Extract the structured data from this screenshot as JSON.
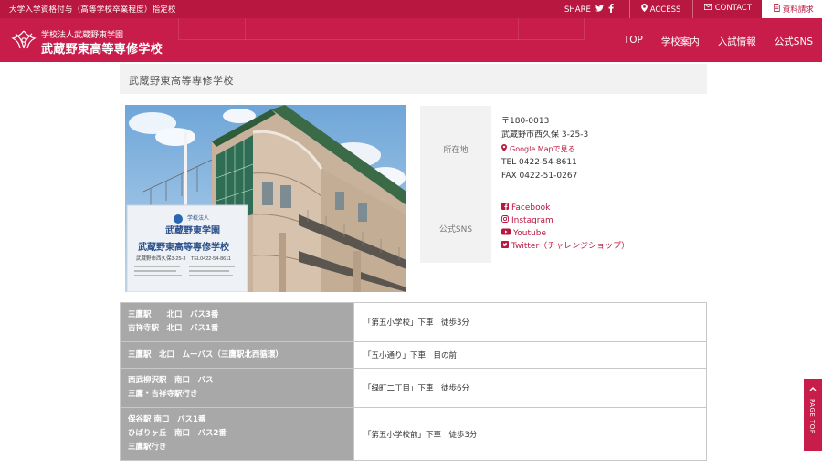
{
  "topbar": {
    "tagline": "大学入学資格付与（高等学校卒業程度）指定校",
    "share_label": "SHARE",
    "access_label": "ACCESS",
    "contact_label": "CONTACT",
    "request_label": "資料請求"
  },
  "header": {
    "org_name": "学校法人武蔵野東学園",
    "school_name": "武蔵野東高等専修学校",
    "nav": [
      "TOP",
      "学校案内",
      "入試情報",
      "公式SNS"
    ]
  },
  "page_title": "武蔵野東高等専修学校",
  "photo": {
    "sign_org": "学校法人",
    "sign_name1": "武蔵野東学園",
    "sign_name2": "武蔵野東高等専修学校",
    "sign_addr": "武蔵野市西久保3-25-3",
    "sign_tel": "TEL0422-54-8611"
  },
  "info": {
    "address_label": "所在地",
    "postal": "〒180-0013",
    "address": "武蔵野市西久保 3-25-3",
    "map_link": "Google Mapで見る",
    "tel": "TEL 0422-54-8611",
    "fax": "FAX 0422-51-0267",
    "sns_label": "公式SNS",
    "sns": [
      {
        "icon": "facebook-icon",
        "label": "Facebook"
      },
      {
        "icon": "instagram-icon",
        "label": "Instagram"
      },
      {
        "icon": "youtube-icon",
        "label": "Youtube"
      },
      {
        "icon": "twitter-icon",
        "label": "Twitter（チャレンジショップ）"
      }
    ]
  },
  "access_table": [
    {
      "route": [
        "三鷹駅　　北口　バス3番",
        "吉祥寺駅　北口　バス1番"
      ],
      "stop": "「第五小学校」下車　徒歩3分"
    },
    {
      "route": [
        "三鷹駅　北口　ムーバス（三鷹駅北西循環）"
      ],
      "stop": "「五小通り」下車　目の前"
    },
    {
      "route": [
        "西武柳沢駅　南口　バス",
        "三鷹・吉祥寺駅行き"
      ],
      "stop": "「緑町二丁目」下車　徒歩6分"
    },
    {
      "route": [
        "保谷駅 南口　バス1番",
        "ひばりヶ丘　南口　バス2番",
        "三鷹駅行き"
      ],
      "stop": "「第五小学校前」下車　徒歩3分"
    }
  ],
  "page_top_label": "PAGE TOP",
  "colors": {
    "brand": "#c81d4a",
    "brand_dark": "#b8173f",
    "route_cell": "#a8a8a8"
  }
}
